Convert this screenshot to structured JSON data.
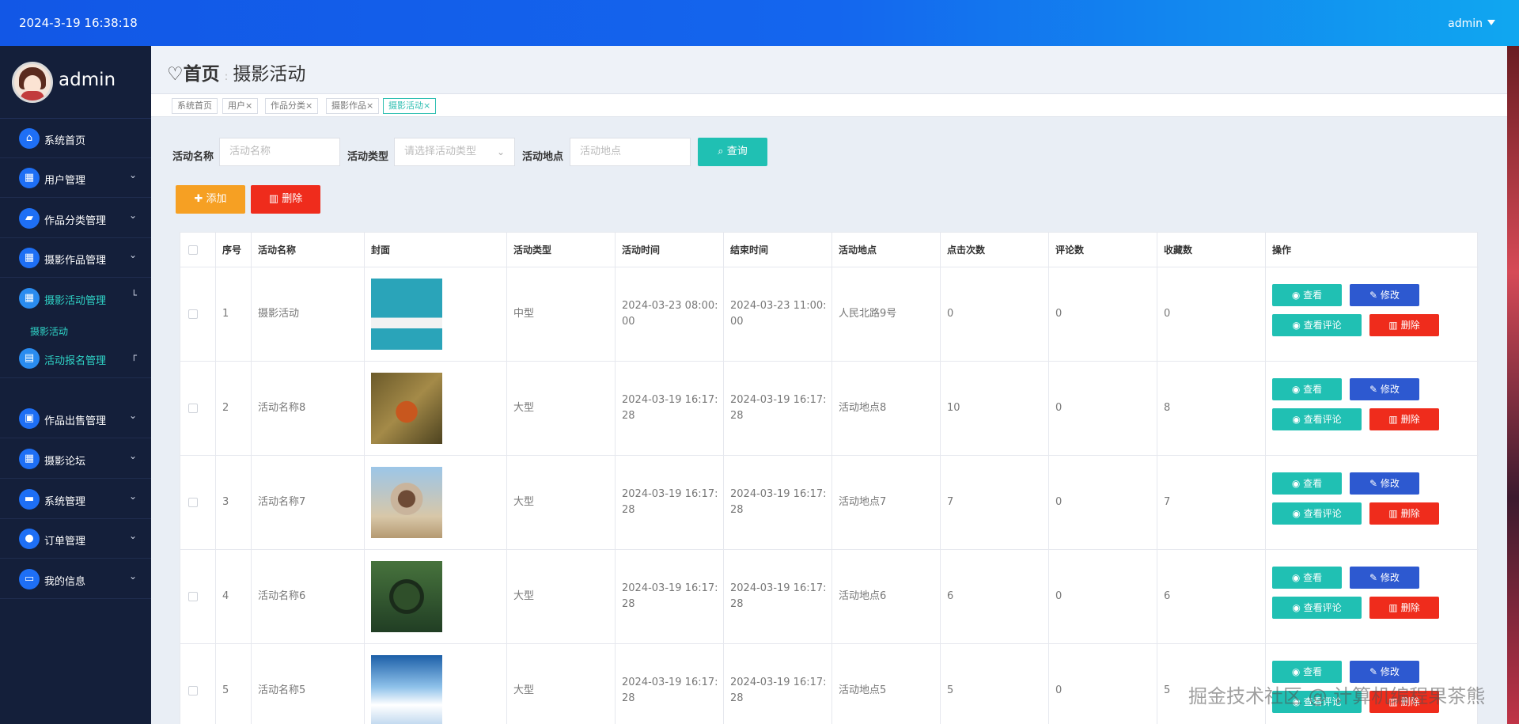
{
  "header": {
    "datetime": "2024-3-19 16:38:18",
    "user": "admin"
  },
  "profile": {
    "name": "admin"
  },
  "sidebar": {
    "items": [
      {
        "label": "系统首页",
        "icon": "home-icon",
        "glyph": "⌂"
      },
      {
        "label": "用户管理",
        "icon": "grid-icon",
        "glyph": "▦"
      },
      {
        "label": "作品分类管理",
        "icon": "category-icon",
        "glyph": "▰"
      },
      {
        "label": "摄影作品管理",
        "icon": "grid-icon",
        "glyph": "▦"
      },
      {
        "label": "摄影活动管理",
        "icon": "grid-icon",
        "glyph": "▦"
      },
      {
        "label": "活动报名管理",
        "icon": "clipboard-icon",
        "glyph": "▤"
      },
      {
        "label": "作品出售管理",
        "icon": "briefcase-icon",
        "glyph": "▣"
      },
      {
        "label": "摄影论坛",
        "icon": "grid-icon",
        "glyph": "▦"
      },
      {
        "label": "系统管理",
        "icon": "chat-icon",
        "glyph": "▬"
      },
      {
        "label": "订单管理",
        "icon": "user-icon",
        "glyph": "●"
      },
      {
        "label": "我的信息",
        "icon": "card-icon",
        "glyph": "▭"
      }
    ],
    "subitem": "摄影活动"
  },
  "breadcrumb": {
    "home": "首页",
    "current": "摄影活动"
  },
  "tabs": [
    {
      "label": "系统首页"
    },
    {
      "label": "用户×"
    },
    {
      "label": "作品分类×"
    },
    {
      "label": "摄影作品×"
    },
    {
      "label": "摄影活动×"
    }
  ],
  "filters": {
    "name_label": "活动名称",
    "name_placeholder": "活动名称",
    "type_label": "活动类型",
    "type_placeholder": "请选择活动类型",
    "location_label": "活动地点",
    "location_placeholder": "活动地点",
    "query": "查询"
  },
  "actions": {
    "add": "添加",
    "delete": "删除"
  },
  "table": {
    "headers": [
      "序号",
      "活动名称",
      "封面",
      "活动类型",
      "活动时间",
      "结束时间",
      "活动地点",
      "点击次数",
      "评论数",
      "收藏数",
      "操作"
    ],
    "row_buttons": {
      "view": "查看",
      "edit": "修改",
      "comments": "查看评论",
      "delete": "删除"
    },
    "rows": [
      {
        "no": "1",
        "name": "摄影活动",
        "type": "中型",
        "start": "2024-03-23 08:00:00",
        "end": "2024-03-23 11:00:00",
        "location": "人民北路9号",
        "clicks": "0",
        "comments": "0",
        "favorites": "0"
      },
      {
        "no": "2",
        "name": "活动名称8",
        "type": "大型",
        "start": "2024-03-19 16:17:28",
        "end": "2024-03-19 16:17:28",
        "location": "活动地点8",
        "clicks": "10",
        "comments": "0",
        "favorites": "8"
      },
      {
        "no": "3",
        "name": "活动名称7",
        "type": "大型",
        "start": "2024-03-19 16:17:28",
        "end": "2024-03-19 16:17:28",
        "location": "活动地点7",
        "clicks": "7",
        "comments": "0",
        "favorites": "7"
      },
      {
        "no": "4",
        "name": "活动名称6",
        "type": "大型",
        "start": "2024-03-19 16:17:28",
        "end": "2024-03-19 16:17:28",
        "location": "活动地点6",
        "clicks": "6",
        "comments": "0",
        "favorites": "6"
      },
      {
        "no": "5",
        "name": "活动名称5",
        "type": "大型",
        "start": "2024-03-19 16:17:28",
        "end": "2024-03-19 16:17:28",
        "location": "活动地点5",
        "clicks": "5",
        "comments": "0",
        "favorites": "5"
      }
    ]
  },
  "watermark": "掘金技术社区 @ 计算机编程果茶熊",
  "colors": {
    "primary": "#1466ee",
    "teal": "#20c0b3",
    "orange": "#f6a023",
    "red": "#ef2c1c",
    "blue_button": "#2d59d0",
    "sidebar": "#141f3a"
  }
}
